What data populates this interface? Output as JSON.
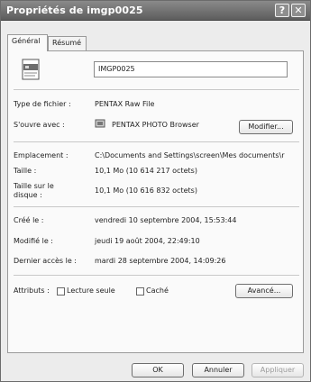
{
  "window": {
    "title": "Propriétés de imgp0025"
  },
  "titlebar": {
    "help_glyph": "?",
    "close_glyph": "✕"
  },
  "tabs": [
    {
      "label": "Général"
    },
    {
      "label": "Résumé"
    }
  ],
  "file": {
    "name": "IMGP0025"
  },
  "rows": {
    "type_label": "Type de fichier :",
    "type_value": "PENTAX Raw File",
    "openwith_label": "S'ouvre avec :",
    "openwith_value": "PENTAX PHOTO Browser",
    "location_label": "Emplacement :",
    "location_value": "C:\\Documents and Settings\\screen\\Mes documents\\r",
    "size_label": "Taille :",
    "size_value": "10,1 Mo (10 614 217 octets)",
    "disksize_label_1": "Taille sur le",
    "disksize_label_2": "disque :",
    "disksize_value": "10,1 Mo (10 616 832 octets)",
    "created_label": "Créé le :",
    "created_value": "vendredi 10 septembre 2004, 15:53:44",
    "modified_label": "Modifié le :",
    "modified_value": "jeudi 19 août 2004, 22:49:10",
    "accessed_label": "Dernier accès le :",
    "accessed_value": "mardi 28 septembre 2004, 14:09:26",
    "attributes_label": "Attributs :",
    "readonly_label": "Lecture seule",
    "hidden_label": "Caché"
  },
  "buttons": {
    "change": "Modifier...",
    "advanced": "Avancé...",
    "ok": "OK",
    "cancel": "Annuler",
    "apply": "Appliquer"
  }
}
